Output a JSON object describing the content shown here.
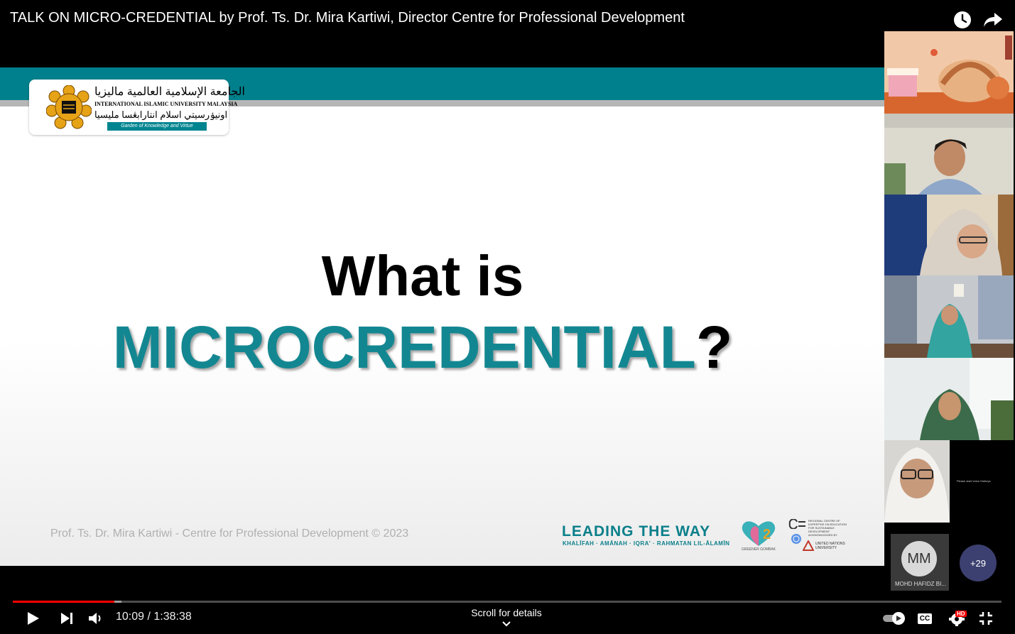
{
  "video": {
    "title": "TALK ON MICRO-CREDENTIAL by Prof. Ts. Dr. Mira Kartiwi, Director Centre for Professional Development",
    "current_time": "10:09",
    "duration": "1:38:38",
    "time_display": "10:09 / 1:38:38",
    "progress_fraction": 0.103,
    "buffered_fraction": 0.11,
    "scroll_hint": "Scroll for details"
  },
  "top_icons": {
    "watch_later": "clock-icon",
    "share": "share-arrow-icon"
  },
  "slide": {
    "logo": {
      "arabic_name": "الجامعة الإسلامية العالمية ماليزيا",
      "english_name": "INTERNATIONAL ISLAMIC UNIVERSITY MALAYSIA",
      "malay_jawi": "اونيۏرسيتي اسلام انتارابڠسا مليسيا",
      "tagline": "Garden of Knowledge and Virtue"
    },
    "heading_line1": "What is",
    "heading_word": "MICROCREDENTIAL",
    "heading_punct": "?",
    "footer_credit": "Prof. Ts. Dr. Mira Kartiwi - Centre for Professional Development © 2023",
    "branding": {
      "title": "LEADING THE WAY",
      "subtitle": "KHALĪFAH · AMĀNAH · IQRA' · RAHMATAN LIL-ĀLAMĪN",
      "greener_label": "GREENER GOMBAK",
      "rcce_text": "REGIONAL CENTRE OF EXPERTISE ON EDUCATION FOR SUSTAINABLE DEVELOPMENT ACKNOWLEDGED BY",
      "unu_text": "UNITED NATIONS UNIVERSITY"
    },
    "colors": {
      "teal": "#00808c",
      "heading_teal": "#138791"
    }
  },
  "participants": {
    "tiles": [
      {
        "kind": "pastry-background"
      },
      {
        "kind": "man-office"
      },
      {
        "kind": "woman-hijab-chair"
      },
      {
        "kind": "woman-hijab-office"
      },
      {
        "kind": "woman-hijab-window"
      },
      {
        "kind": "woman-hijab-glasses"
      }
    ],
    "note": "Please start Voice Hotkeys",
    "mm_tile": {
      "initials": "MM",
      "name": "MOHD HAFIDZ BI..."
    },
    "more_count": "+29"
  },
  "controls": {
    "play": "play-icon",
    "next": "next-icon",
    "volume": "volume-icon",
    "autoplay": "autoplay-toggle-icon",
    "captions": "CC",
    "settings_badge": "HD",
    "fullscreen_exit": "exit-fullscreen-icon"
  },
  "progress_color": "#ff0000"
}
